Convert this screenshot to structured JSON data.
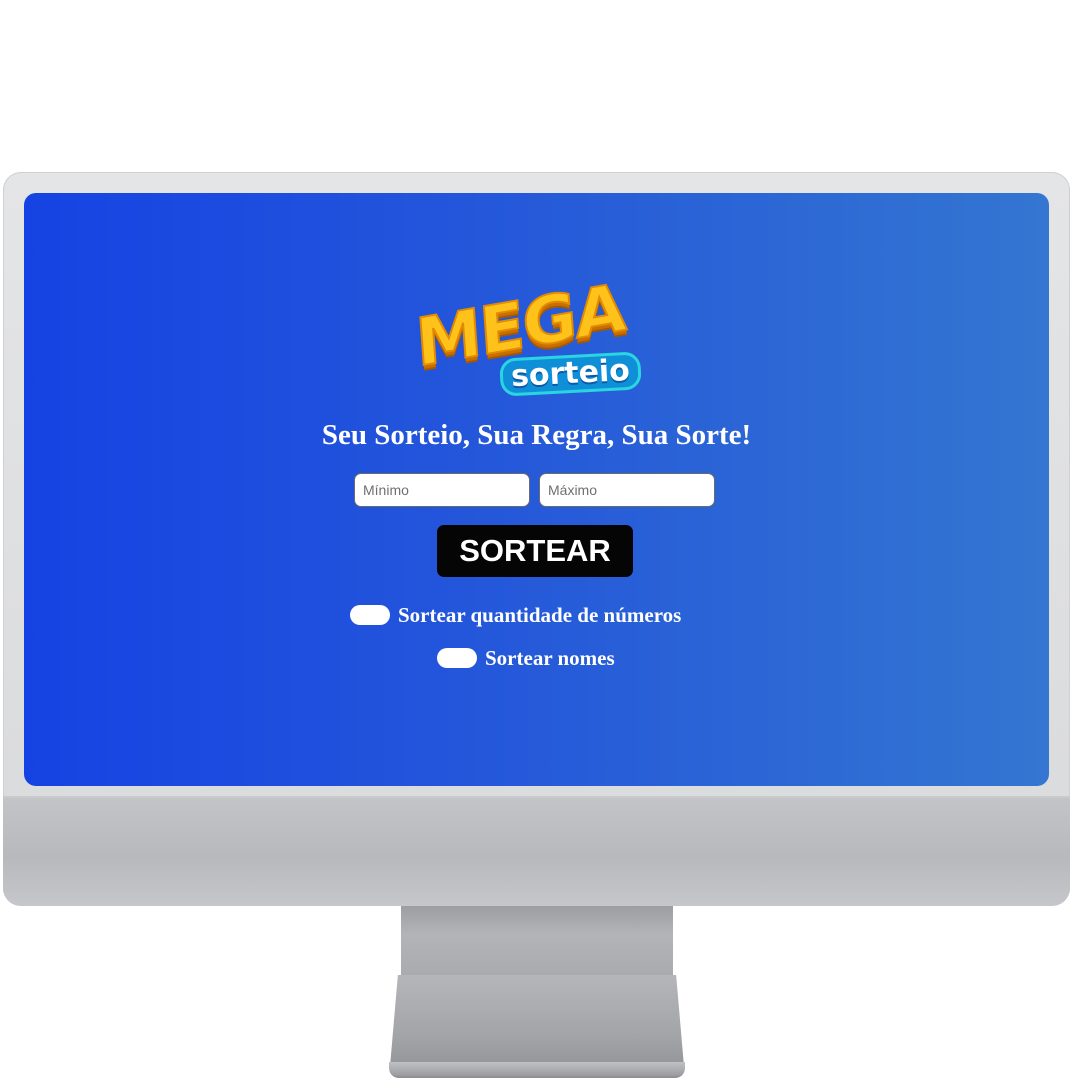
{
  "logo": {
    "mega": "MEGA",
    "sorteio": "sorteio"
  },
  "headline": "Seu Sorteio, Sua Regra, Sua Sorte!",
  "form": {
    "min_placeholder": "Mínimo",
    "max_placeholder": "Máximo",
    "min_value": "",
    "max_value": "",
    "submit_label": "SORTEAR"
  },
  "options": [
    {
      "label": "Sortear quantidade de números",
      "enabled": false
    },
    {
      "label": "Sortear nomes",
      "enabled": false
    }
  ],
  "colors": {
    "background_start": "#1543e3",
    "background_end": "#3476d1",
    "button": "#050505",
    "logo_mega": "#ffc21a",
    "logo_sorteio": "#0f8fd8"
  }
}
